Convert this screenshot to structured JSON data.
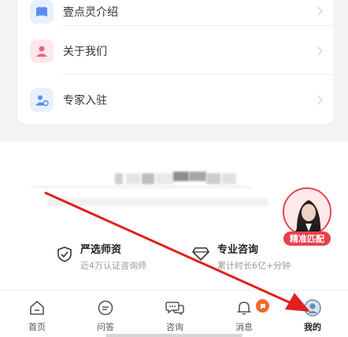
{
  "menu": {
    "items": [
      {
        "label": "壹点灵介绍",
        "icon": "book-icon",
        "color": "#5b8def"
      },
      {
        "label": "关于我们",
        "icon": "user-icon",
        "color": "#f06080"
      },
      {
        "label": "专家入驻",
        "icon": "expert-icon",
        "color": "#5b8def"
      }
    ]
  },
  "features": [
    {
      "title": "严选师资",
      "subtitle": "近4万认证咨询师",
      "icon": "shield-icon"
    },
    {
      "title": "专业咨询",
      "subtitle": "累计时长6亿+分钟",
      "icon": "diamond-icon"
    }
  ],
  "match_badge": {
    "label": "精准匹配",
    "color": "#e8404a"
  },
  "tabbar": {
    "tabs": [
      {
        "label": "首页",
        "icon": "home-icon"
      },
      {
        "label": "问答",
        "icon": "qa-icon"
      },
      {
        "label": "咨询",
        "icon": "consult-icon"
      },
      {
        "label": "消息",
        "icon": "bell-icon"
      },
      {
        "label": "我的",
        "icon": "profile-icon",
        "active": true
      }
    ]
  },
  "annotation": {
    "color": "#e0201a"
  }
}
